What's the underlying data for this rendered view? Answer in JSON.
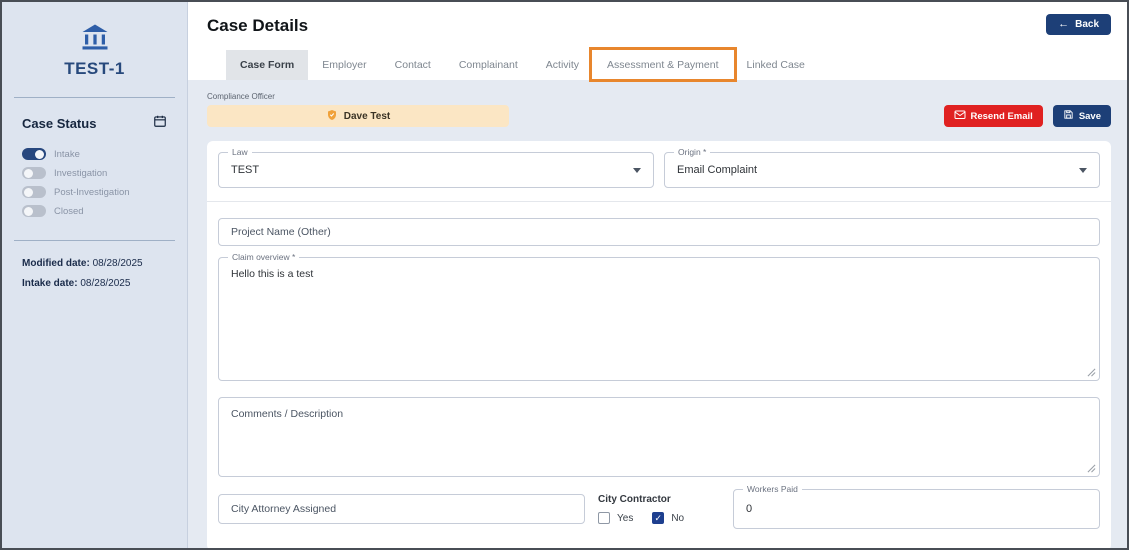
{
  "sidebar": {
    "case_id": "TEST-1",
    "section_title": "Case Status",
    "statuses": [
      {
        "label": "Intake",
        "state": "on"
      },
      {
        "label": "Investigation",
        "state": "off"
      },
      {
        "label": "Post-Investigation",
        "state": "off"
      },
      {
        "label": "Closed",
        "state": "off"
      }
    ],
    "modified_date_label": "Modified date:",
    "modified_date": "08/28/2025",
    "intake_date_label": "Intake date:",
    "intake_date": "08/28/2025"
  },
  "header": {
    "title": "Case Details",
    "back_label": "Back"
  },
  "tabs": [
    {
      "label": "Case Form",
      "active": true
    },
    {
      "label": "Employer",
      "active": false
    },
    {
      "label": "Contact",
      "active": false
    },
    {
      "label": "Complainant",
      "active": false
    },
    {
      "label": "Activity",
      "active": false
    },
    {
      "label": "Assessment & Payment",
      "active": false,
      "highlighted": true
    },
    {
      "label": "Linked Case",
      "active": false
    }
  ],
  "toolbar": {
    "compliance_officer_label": "Compliance Officer",
    "officer_chip_label": "Dave Test",
    "resend_email_label": "Resend Email",
    "save_label": "Save"
  },
  "form": {
    "law": {
      "label": "Law",
      "value": "TEST"
    },
    "origin": {
      "label": "Origin *",
      "value": "Email Complaint"
    },
    "project_name": {
      "placeholder": "Project Name (Other)",
      "value": ""
    },
    "claim_overview": {
      "label": "Claim overview *",
      "value": "Hello this is a test"
    },
    "comments": {
      "placeholder": "Comments / Description",
      "value": ""
    },
    "city_attorney": {
      "placeholder": "City Attorney Assigned",
      "value": ""
    },
    "city_contractor": {
      "label": "City Contractor",
      "options": [
        {
          "label": "Yes",
          "checked": false
        },
        {
          "label": "No",
          "checked": true
        }
      ]
    },
    "workers_paid": {
      "label": "Workers Paid",
      "value": "0"
    }
  },
  "colors": {
    "accent_navy": "#1d3f77",
    "danger_red": "#e02121",
    "highlight_orange": "#e8862d",
    "chip_bg": "#fbe6c4",
    "sidebar_bg": "#dde4ef",
    "content_bg": "#e5eaf2"
  }
}
